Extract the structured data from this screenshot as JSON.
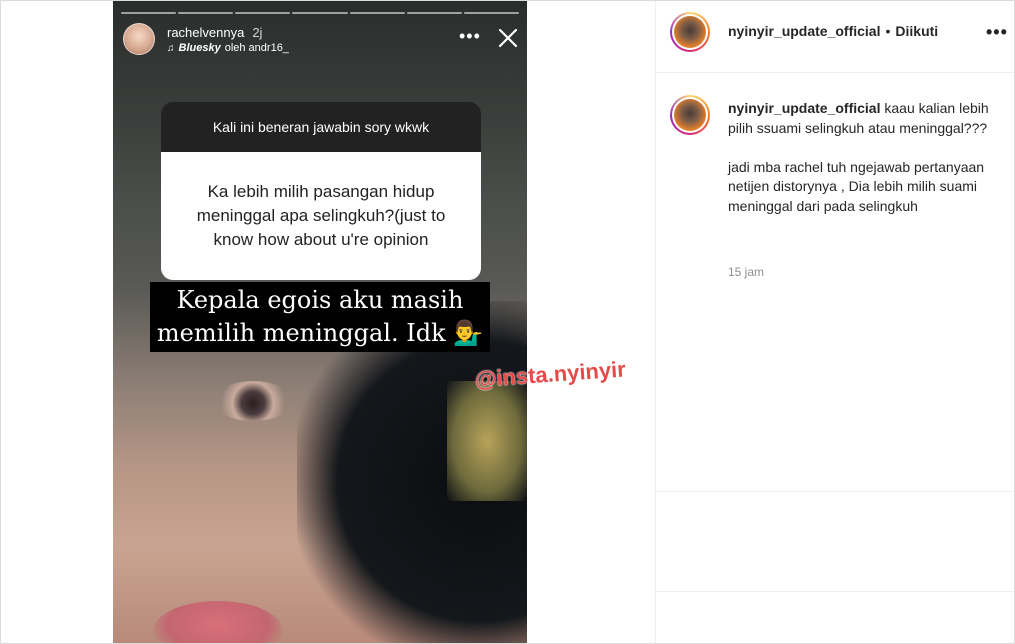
{
  "story": {
    "username": "rachelvennya",
    "time": "2j",
    "music_brand": "Bluesky",
    "music_by": "oleh andr16_",
    "more_icon": "more-horizontal-icon",
    "close_icon": "close-icon",
    "segments": 7,
    "question_header": "Kali ini beneran jawabin sory wkwk",
    "question_body": "Ka lebih milih pasangan hidup meninggal apa selingkuh?(just to know how about u're opinion",
    "answer": "Kepala egois aku masih memilih meninggal. Idk 💁‍♂️",
    "watermark": "@insta.nyinyir"
  },
  "post": {
    "username": "nyinyir_update_official",
    "separator": "•",
    "follow_status": "Diikuti",
    "caption_user": "nyinyir_update_official",
    "caption_line1": "kaau kalian lebih pilih ssuami selingkuh atau meninggal???",
    "caption_line2": "jadi mba rachel tuh ngejawab pertanyaan netijen distorynya , Dia lebih milih suami meninggal dari pada selingkuh",
    "time": "15 jam"
  },
  "colors": {
    "accent_watermark": "#e64a4a",
    "question_header_bg": "#222222"
  }
}
